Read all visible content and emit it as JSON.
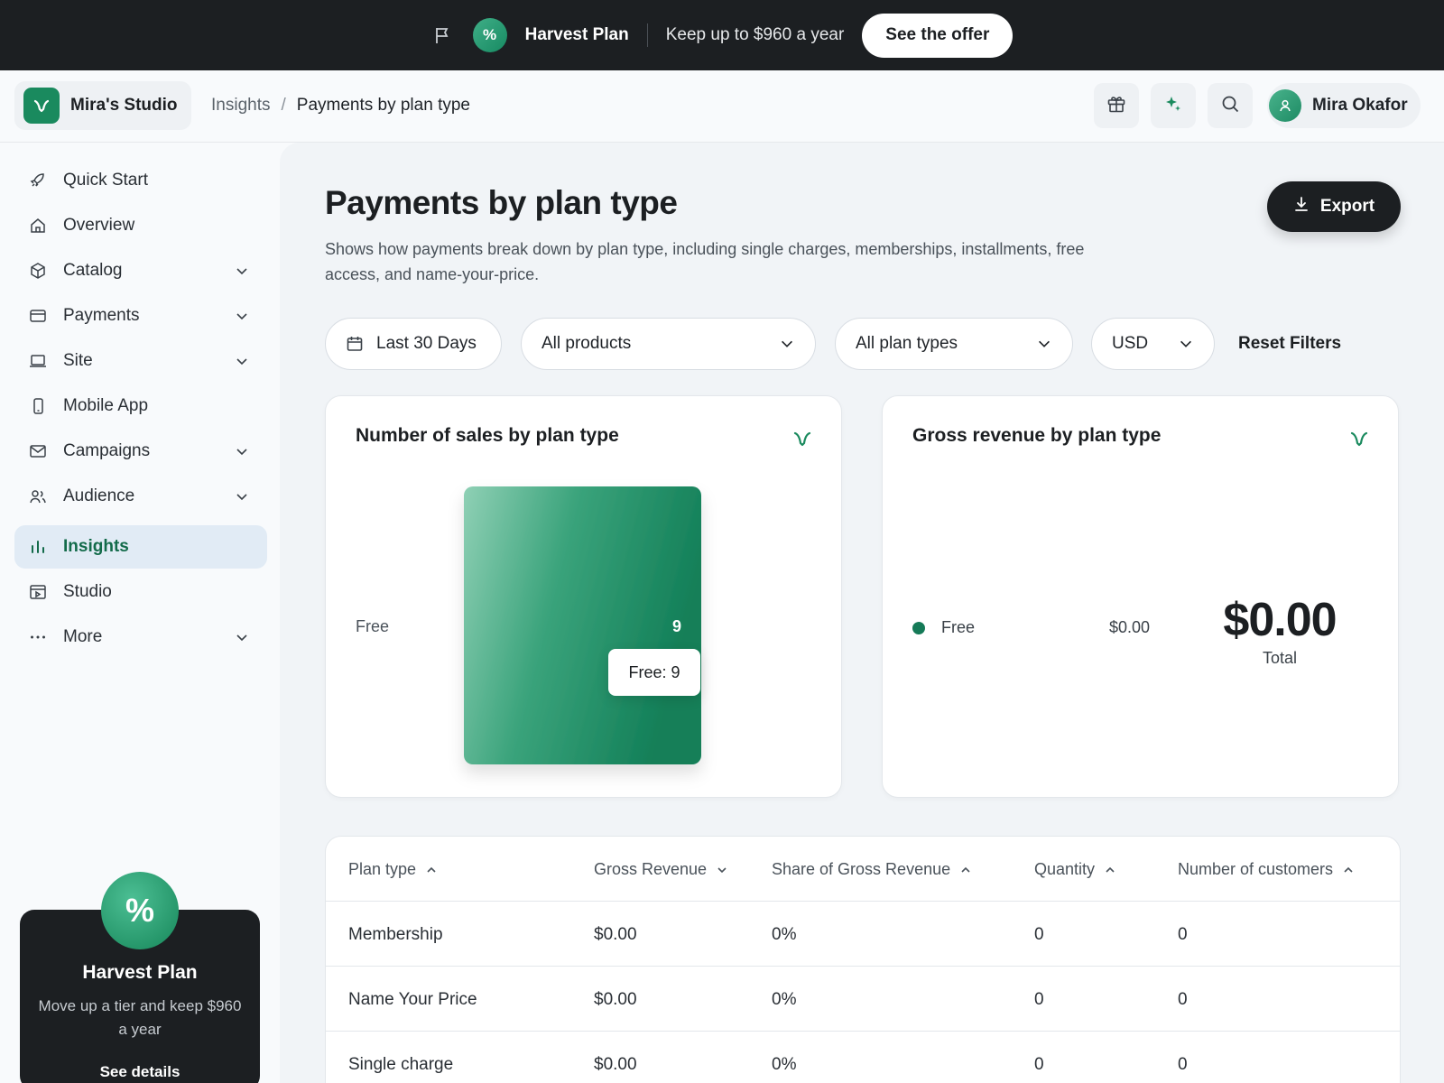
{
  "promo": {
    "plan_name": "Harvest Plan",
    "badge": "%",
    "message": "Keep up to $960 a year",
    "cta": "See the offer"
  },
  "header": {
    "brand": "Mira's Studio",
    "breadcrumb_parent": "Insights",
    "breadcrumb_sep": "/",
    "breadcrumb_current": "Payments by plan type",
    "user_name": "Mira Okafor"
  },
  "sidebar": {
    "items": [
      {
        "label": "Quick Start",
        "icon": "rocket-icon",
        "has_chevron": false
      },
      {
        "label": "Overview",
        "icon": "home-icon",
        "has_chevron": false
      },
      {
        "label": "Catalog",
        "icon": "box-icon",
        "has_chevron": true
      },
      {
        "label": "Payments",
        "icon": "card-icon",
        "has_chevron": true
      },
      {
        "label": "Site",
        "icon": "laptop-icon",
        "has_chevron": true
      },
      {
        "label": "Mobile App",
        "icon": "phone-icon",
        "has_chevron": false
      },
      {
        "label": "Campaigns",
        "icon": "mail-icon",
        "has_chevron": true
      },
      {
        "label": "Audience",
        "icon": "users-icon",
        "has_chevron": true
      },
      {
        "label": "Insights",
        "icon": "bar-chart-icon",
        "has_chevron": false,
        "active": true
      },
      {
        "label": "Studio",
        "icon": "studio-icon",
        "has_chevron": false
      },
      {
        "label": "More",
        "icon": "more-icon",
        "has_chevron": true
      }
    ],
    "upsell": {
      "badge": "%",
      "title": "Harvest Plan",
      "description": "Move up a tier and keep $960 a year",
      "link": "See details"
    }
  },
  "page": {
    "title": "Payments by plan type",
    "description": "Shows how payments break down by plan type, including single charges, memberships, installments, free access, and name-your-price.",
    "export_label": "Export"
  },
  "filters": {
    "date_range": "Last 30 Days",
    "products": "All products",
    "plan_types": "All plan types",
    "currency": "USD",
    "reset": "Reset Filters"
  },
  "sales_card": {
    "title": "Number of sales by plan type",
    "tooltip": "Free: 9"
  },
  "revenue_card": {
    "title": "Gross revenue by plan type",
    "legend_label": "Free",
    "legend_value": "$0.00",
    "total_value": "$0.00",
    "total_label": "Total"
  },
  "chart_data": {
    "type": "bar",
    "orientation": "horizontal",
    "categories": [
      "Free"
    ],
    "values": [
      9
    ],
    "data_labels": [
      "9"
    ],
    "title": "Number of sales by plan type"
  },
  "table": {
    "columns": [
      {
        "label": "Plan type",
        "sort": "asc"
      },
      {
        "label": "Gross Revenue",
        "sort": "desc"
      },
      {
        "label": "Share of Gross Revenue",
        "sort": "asc"
      },
      {
        "label": "Quantity",
        "sort": "asc"
      },
      {
        "label": "Number of customers",
        "sort": "asc"
      }
    ],
    "rows": [
      [
        "Membership",
        "$0.00",
        "0%",
        "0",
        "0"
      ],
      [
        "Name Your Price",
        "$0.00",
        "0%",
        "0",
        "0"
      ],
      [
        "Single charge",
        "$0.00",
        "0%",
        "0",
        "0"
      ]
    ]
  },
  "colors": {
    "accent": "#1a8a5e",
    "dark": "#1c1f22",
    "active_nav_bg": "#e1ebf5"
  }
}
